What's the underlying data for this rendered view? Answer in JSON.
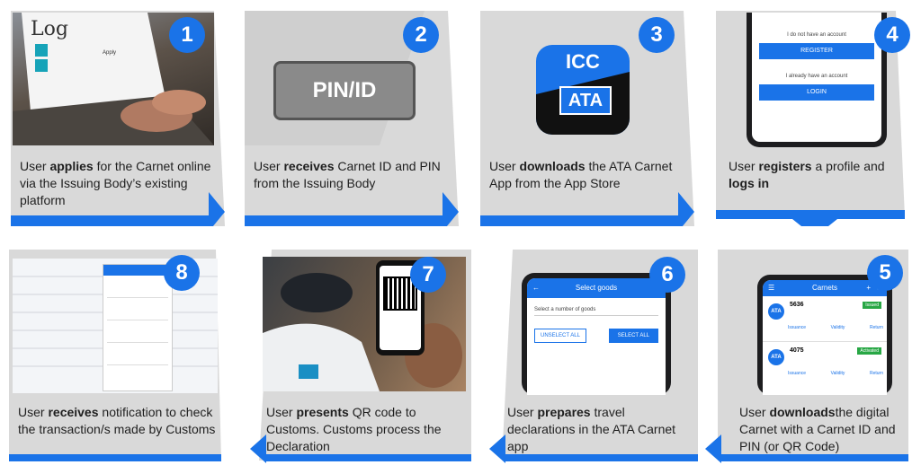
{
  "steps": [
    {
      "num": "1",
      "pre": "User ",
      "bold": "applies",
      "post": " for the Carnet online  via the Issuing Body’s existing platform",
      "mockup": {
        "logo": "Log",
        "links": [
          "Apply"
        ]
      }
    },
    {
      "num": "2",
      "pre": "User ",
      "bold": "receives",
      "post": " Carnet ID and PIN from the Issuing Body",
      "mockup": {
        "badge": "PIN/ID"
      }
    },
    {
      "num": "3",
      "pre": "User ",
      "bold": "downloads",
      "post": " the ATA Carnet App from the App Store",
      "mockup": {
        "icc": "ICC",
        "ata": "ATA"
      }
    },
    {
      "num": "4",
      "pre": "User",
      "bold": "registers",
      "post": " a profile and",
      "bold2": "logs in",
      "mockup": {
        "no_account": "I do not have an account",
        "register": "REGISTER",
        "have_account": "I already have an account",
        "login": "LOGIN"
      }
    },
    {
      "num": "5",
      "pre": "User",
      "bold": "downloads",
      "post": "the digital Carnet with a Carnet ID and PIN (or QR Code)",
      "mockup": {
        "title": "Carnets",
        "items": [
          {
            "id": "5636",
            "status": "Issued"
          },
          {
            "id": "4075",
            "status": "Activated"
          }
        ],
        "actions": [
          "Issuance",
          "Validity",
          "Return"
        ]
      }
    },
    {
      "num": "6",
      "pre": "User ",
      "bold": "prepares",
      "post": "  travel declarations in the ATA Carnet app",
      "mockup": {
        "title": "Select goods",
        "select_prompt": "Select a number of goods",
        "unselect": "UNSELECT ALL",
        "select": "SELECT ALL"
      }
    },
    {
      "num": "7",
      "pre": "User ",
      "bold": "presents",
      "post": " QR code to Customs. Customs process the Declaration",
      "mockup": {}
    },
    {
      "num": "8",
      "pre": "User ",
      "bold": "receives",
      "post": " notification to check the transaction/s made by Customs",
      "mockup": {}
    }
  ],
  "colors": {
    "accent": "#1a73e8",
    "card": "#d9d9d9"
  }
}
